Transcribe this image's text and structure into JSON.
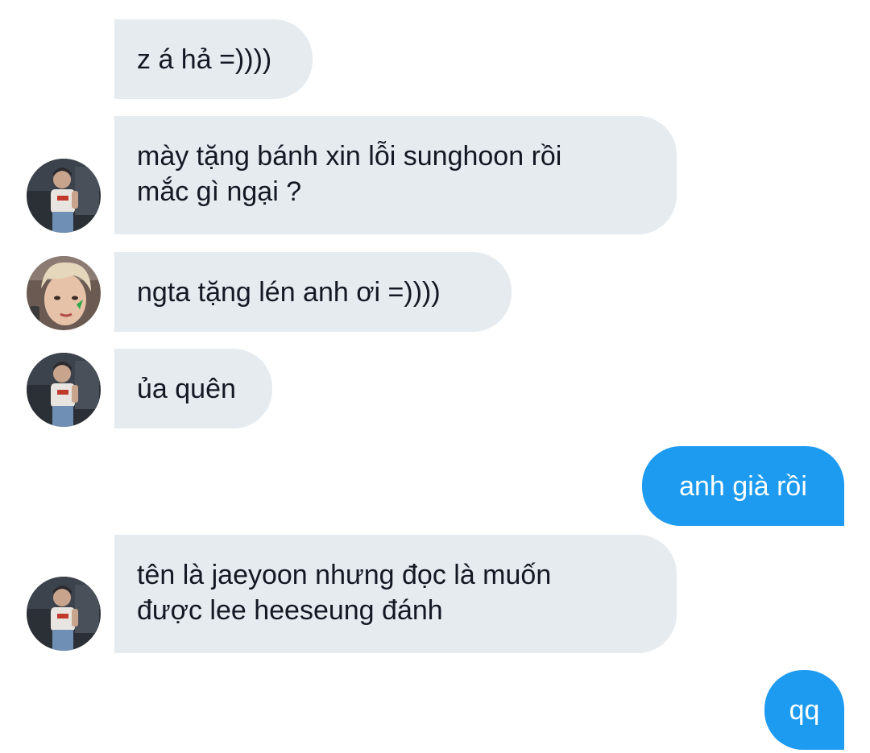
{
  "messages": [
    {
      "id": "m1",
      "direction": "incoming",
      "lines": [
        "z á hả =))))"
      ],
      "avatar": "none"
    },
    {
      "id": "m2",
      "direction": "incoming",
      "lines": [
        "mày tặng bánh xin lỗi sunghoon rồi",
        "mắc gì ngại ?"
      ],
      "avatar": "boy-dark-room"
    },
    {
      "id": "m3",
      "direction": "incoming",
      "lines": [
        "ngta tặng lén anh ơi =))))"
      ],
      "avatar": "blonde-boy-sticker"
    },
    {
      "id": "m4",
      "direction": "incoming",
      "lines": [
        "ủa quên"
      ],
      "avatar": "boy-dark-room"
    },
    {
      "id": "m5",
      "direction": "outgoing",
      "lines": [
        "anh già rồi"
      ]
    },
    {
      "id": "m6",
      "direction": "incoming",
      "lines": [
        "tên là jaeyoon nhưng đọc là muốn",
        "được lee heeseung đánh"
      ],
      "avatar": "boy-dark-room"
    },
    {
      "id": "m7",
      "direction": "outgoing",
      "lines": [
        "qq"
      ]
    }
  ],
  "colors": {
    "incoming_bubble": "#e6ebf0",
    "outgoing_bubble": "#1d9bf0",
    "incoming_text": "#141823",
    "outgoing_text": "#ffffff",
    "background": "#ffffff"
  }
}
